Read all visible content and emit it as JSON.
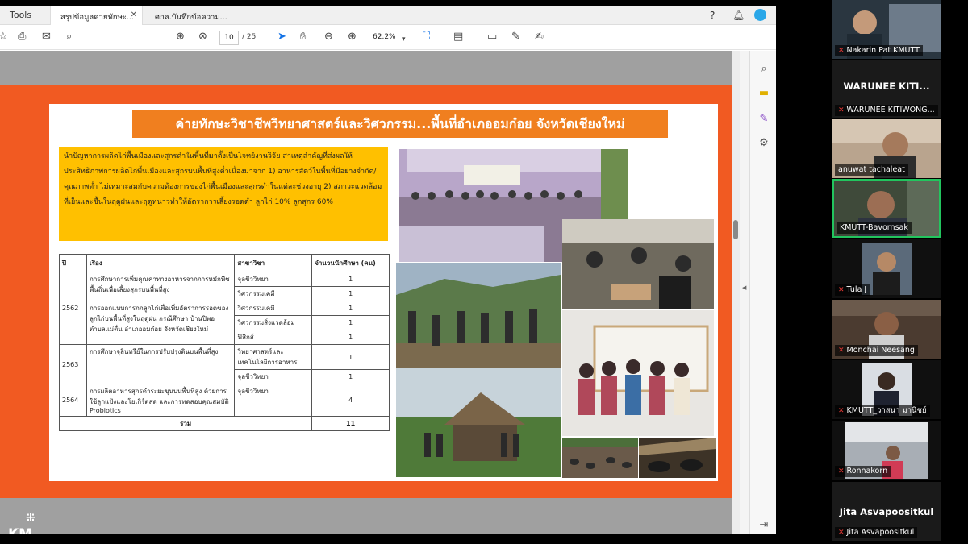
{
  "acrobat": {
    "tools_label": "Tools",
    "tabs": [
      {
        "label": "สรุปข้อมูลค่ายทักษะ...",
        "active": true
      },
      {
        "label": "ศกล.บันทึกข้อความ...",
        "active": false
      }
    ],
    "toolbar": {
      "page_current": "10",
      "page_total": "/ 25",
      "zoom": "62.2%"
    }
  },
  "slide": {
    "title": "ค่ายทักษะวิชาชีพวิทยาศาสตร์และวิศวกรรม...พื้นที่อำเภออมก๋อย จังหวัดเชียงใหม่",
    "summary": "นำปัญหาการผลิตไก่พื้นเมืองและสุกรดำในพื้นที่มาตั้งเป็นโจทย์งานวิจัย สาเหตุสำคัญที่ส่งผลให้ประสิทธิภาพการผลิตไก่พื้นเมืองและสุกรบนพื้นที่สูงต่ำเนื่องมาจาก 1) อาหารสัตว์ในพื้นที่มีอย่างจำกัด/คุณภาพต่ำ ไม่เหมาะสมกับความต้องการของไก่พื้นเมืองและสุกรดำในแต่ละช่วงอายุ 2) สภาวะแวดล้อมที่เย็นและชื้นในฤดูฝนและฤดูหนาวทำให้อัตราการเลี้ยงรอดต่ำ ลูกไก่ 10% ลูกสุกร 60%",
    "table": {
      "headers": [
        "ปี",
        "เรื่อง",
        "สาขาวิชา",
        "จำนวนนักศึกษา (คน)"
      ],
      "rows": [
        {
          "year": "2562",
          "topic": "การศึกษาการเพิ่มคุณค่าทางอาหารจากการหมักพืชพื้นถิ่นเพื่อเลี้ยงสุกรบนพื้นที่สูง",
          "majors": [
            "จุลชีววิทยา",
            "วิศวกรรมเคมี"
          ],
          "counts": [
            "1",
            "1"
          ]
        },
        {
          "year": "",
          "topic": "การออกแบบการกกลูกไก่เพื่อเพิ่มอัตราการรอดของลูกไก่บนพื้นที่สูงในฤดูฝน กรณีศึกษา บ้านปิพอ ตำบลแม่ตื่น อำเภออมก๋อย จังหวัดเชียงใหม่",
          "majors": [
            "วิศวกรรมเคมี",
            "วิศวกรรมสิ่งแวดล้อม",
            "ฟิสิกส์"
          ],
          "counts": [
            "1",
            "1",
            "1"
          ]
        },
        {
          "year": "2563",
          "topic": "การศึกษาจุลินทรีย์ในการปรับปรุงดินบนพื้นที่สูง",
          "majors": [
            "วิทยาศาสตร์และเทคโนโลยีการอาหาร",
            "จุลชีววิทยา"
          ],
          "counts": [
            "1",
            "1"
          ]
        },
        {
          "year": "2564",
          "topic": "การผลิตอาหารสุกรดำระยะขุนบนพื้นที่สูง ด้วยการใช้ลูกแป้งและโยเกิร์ตสด และการทดสอบคุณสมบัติ Probiotics",
          "majors": [
            "จุลชีววิทยา"
          ],
          "counts": [
            "4"
          ]
        }
      ],
      "total_label": "รวม",
      "total_value": "11"
    },
    "logo_text": "KM UTT"
  },
  "participants": [
    {
      "name": "Nakarin Pat KMUTT",
      "big_name": "",
      "muted": true
    },
    {
      "name": "WARUNEE KITIWONG...",
      "big_name": "WARUNEE KITI...",
      "muted": true
    },
    {
      "name": "anuwat tachaleat",
      "big_name": "",
      "muted": false
    },
    {
      "name": "KMUTT-Bavornsak",
      "big_name": "",
      "muted": false,
      "speaking": true
    },
    {
      "name": "Tula J",
      "big_name": "",
      "muted": true
    },
    {
      "name": "Monchai Neesang",
      "big_name": "",
      "muted": true
    },
    {
      "name": "KMUTT_วาสนา มานิชย์",
      "big_name": "",
      "muted": true
    },
    {
      "name": "Ronnakorn",
      "big_name": "",
      "muted": true
    },
    {
      "name": "Jita Asvapoositkul",
      "big_name": "Jita Asvapoositkul",
      "muted": true
    }
  ],
  "colors": {
    "slide_orange": "#f15a22",
    "title_orange": "#f07f1f",
    "summary_yellow": "#ffc000",
    "speaking_green": "#22c55e"
  }
}
